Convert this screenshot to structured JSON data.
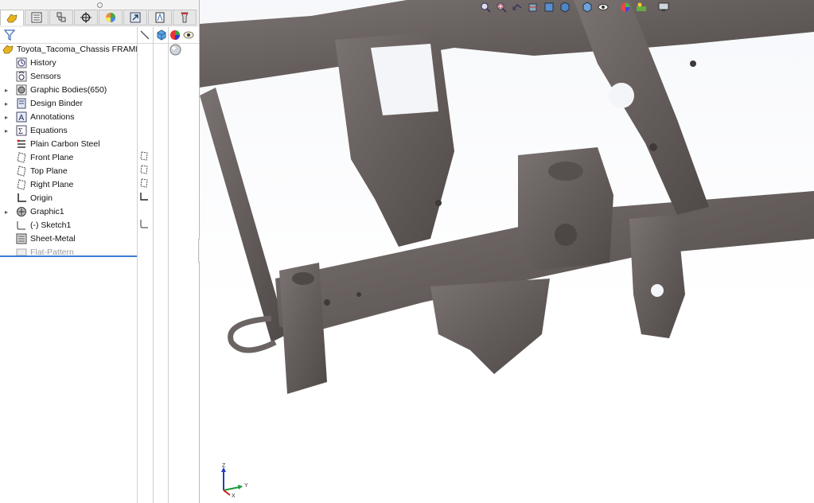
{
  "panel": {
    "tabs": [
      {
        "icon": "feature-manager-icon",
        "active": true
      },
      {
        "icon": "property-manager-icon"
      },
      {
        "icon": "configuration-manager-icon"
      },
      {
        "icon": "dimxpert-icon"
      },
      {
        "icon": "display-manager-icon"
      },
      {
        "icon": "cam-icon"
      },
      {
        "icon": "simulation-icon"
      },
      {
        "icon": "design-checker-icon"
      }
    ],
    "tree": {
      "root_label": "Toyota_Tacoma_Chassis FRAME HORN",
      "items": [
        {
          "label": "History",
          "icon": "history-icon",
          "expandable": false
        },
        {
          "label": "Sensors",
          "icon": "sensors-icon",
          "expandable": false
        },
        {
          "label": "Graphic Bodies(650)",
          "icon": "graphic-bodies-icon",
          "expandable": true
        },
        {
          "label": "Design Binder",
          "icon": "design-binder-icon",
          "expandable": true
        },
        {
          "label": "Annotations",
          "icon": "annotations-icon",
          "expandable": true
        },
        {
          "label": "Equations",
          "icon": "equations-icon",
          "expandable": true
        },
        {
          "label": "Plain Carbon Steel",
          "icon": "material-icon",
          "expandable": false
        },
        {
          "label": "Front Plane",
          "icon": "plane-icon",
          "expandable": false
        },
        {
          "label": "Top Plane",
          "icon": "plane-icon",
          "expandable": false
        },
        {
          "label": "Right Plane",
          "icon": "plane-icon",
          "expandable": false
        },
        {
          "label": "Origin",
          "icon": "origin-icon",
          "expandable": false
        },
        {
          "label": "Graphic1",
          "icon": "graphic-body-icon",
          "expandable": true
        },
        {
          "label": "(-) Sketch1",
          "icon": "sketch-icon",
          "expandable": false
        },
        {
          "label": "Sheet-Metal",
          "icon": "sheet-metal-icon",
          "expandable": false
        },
        {
          "label": "Flat-Pattern",
          "icon": "flat-pattern-icon",
          "expandable": false,
          "suppressed": true
        }
      ]
    }
  },
  "viewport": {
    "model_color": "#6b6462",
    "triad": {
      "x_label": "X",
      "y_label": "Y",
      "z_label": "Z"
    },
    "hud_icons": [
      "zoom-to-fit-icon",
      "zoom-to-area-icon",
      "previous-view-icon",
      "section-view-icon",
      "dynamic-annotation-icon",
      "view-orientation-icon",
      "display-style-icon",
      "hide-show-icon",
      "edit-appearance-icon",
      "apply-scene-icon",
      "view-settings-icon"
    ]
  }
}
